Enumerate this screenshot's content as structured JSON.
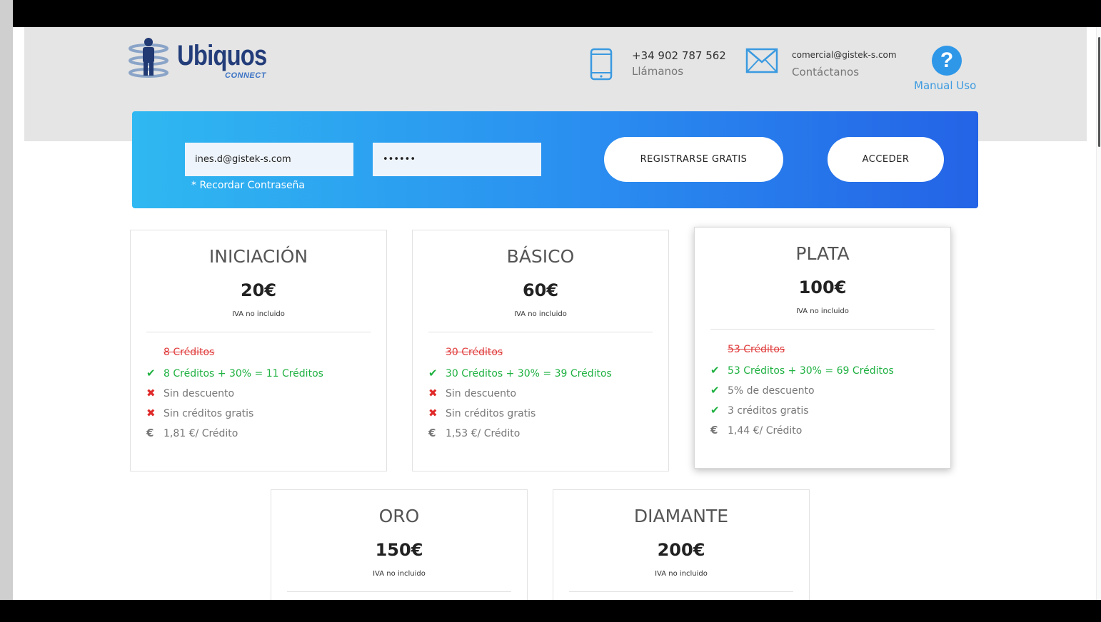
{
  "header": {
    "logo": {
      "word": "Ubiquos",
      "sub": "CONNECT"
    },
    "phone": {
      "number": "+34 902 787 562",
      "label": "Llámanos"
    },
    "email": {
      "address": "comercial@gistek-s.com",
      "label": "Contáctanos"
    },
    "help": {
      "label": "Manual Uso"
    }
  },
  "login": {
    "email_value": "ines.d@gistek-s.com",
    "password_value": "••••••",
    "remember_label": "* Recordar Contraseña",
    "register_label": "REGISTRARSE GRATIS",
    "login_label": "ACCEDER"
  },
  "plans": [
    {
      "title": "INICIACIÓN",
      "price": "20€",
      "vat": "IVA no incluido",
      "features": [
        {
          "icon": "",
          "text": "8 Créditos",
          "style": "old"
        },
        {
          "icon": "check-icon",
          "text": "8 Créditos + 30% = 11 Créditos",
          "style": "green"
        },
        {
          "icon": "x-icon",
          "text": "Sin descuento",
          "style": "grey"
        },
        {
          "icon": "x-icon",
          "text": "Sin créditos gratis",
          "style": "grey"
        },
        {
          "icon": "euro-icon",
          "text": "1,81 €/ Crédito",
          "style": "grey"
        }
      ]
    },
    {
      "title": "BÁSICO",
      "price": "60€",
      "vat": "IVA no incluido",
      "features": [
        {
          "icon": "",
          "text": "30 Créditos",
          "style": "old"
        },
        {
          "icon": "check-icon",
          "text": "30 Créditos + 30% = 39 Créditos",
          "style": "green"
        },
        {
          "icon": "x-icon",
          "text": "Sin descuento",
          "style": "grey"
        },
        {
          "icon": "x-icon",
          "text": "Sin créditos gratis",
          "style": "grey"
        },
        {
          "icon": "euro-icon",
          "text": "1,53 €/ Crédito",
          "style": "grey"
        }
      ]
    },
    {
      "title": "PLATA",
      "price": "100€",
      "vat": "IVA no incluido",
      "features": [
        {
          "icon": "",
          "text": "53 Créditos",
          "style": "old"
        },
        {
          "icon": "check-icon",
          "text": "53 Créditos + 30% = 69 Créditos",
          "style": "green"
        },
        {
          "icon": "check-icon",
          "text": "5% de descuento",
          "style": "grey"
        },
        {
          "icon": "check-icon",
          "text": "3 créditos gratis",
          "style": "grey"
        },
        {
          "icon": "euro-icon",
          "text": "1,44 €/ Crédito",
          "style": "grey"
        }
      ]
    },
    {
      "title": "ORO",
      "price": "150€",
      "vat": "IVA no incluido",
      "features": []
    },
    {
      "title": "DIAMANTE",
      "price": "200€",
      "vat": "IVA no incluido",
      "features": []
    }
  ],
  "colors": {
    "accent_blue": "#2a8df0",
    "success_green": "#1fb141",
    "danger_red": "#e02a2a"
  }
}
